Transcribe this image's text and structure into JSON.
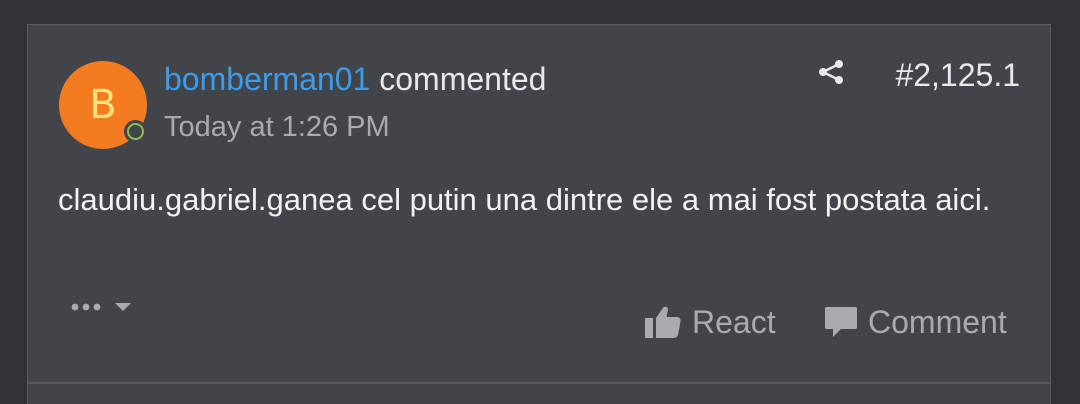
{
  "comment": {
    "author": {
      "name": "bomberman01",
      "avatar_letter": "B",
      "avatar_color": "#f47b20",
      "online": true
    },
    "action_text": "commented",
    "timestamp": "Today at 1:26 PM",
    "post_number": "#2,125.1",
    "body": "claudiu.gabriel.ganea cel putin una dintre ele a mai fost postata aici.",
    "actions": {
      "more_icon": "ellipsis-dropdown-icon",
      "share_icon": "share-icon",
      "react_label": "React",
      "react_icon": "thumbs-up-icon",
      "comment_label": "Comment",
      "comment_icon": "speech-bubble-icon"
    }
  },
  "colors": {
    "background": "#303237",
    "card": "#414449",
    "link": "#3d9be9",
    "text": "#f1f2f3",
    "muted": "#a9abae",
    "online": "#8cc152"
  }
}
